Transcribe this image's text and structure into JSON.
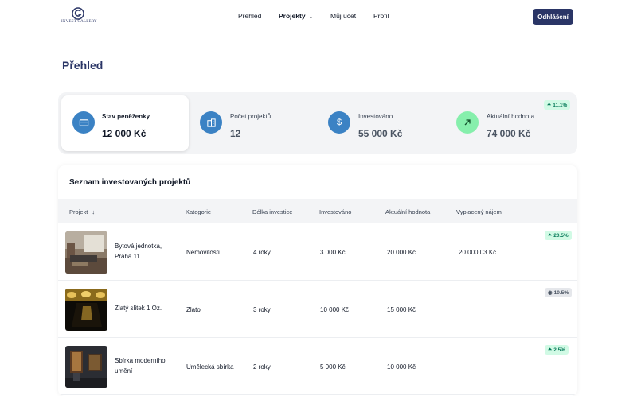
{
  "brand": {
    "logo_text": "INVEST GALLERY"
  },
  "nav": {
    "items": [
      {
        "label": "Přehled"
      },
      {
        "label": "Projekty"
      },
      {
        "label": "Můj účet"
      },
      {
        "label": "Profil"
      }
    ],
    "logout_label": "Odhlášení"
  },
  "page_title": "Přehled",
  "stats": [
    {
      "label": "Stav peněženky",
      "value": "12 000 Kč",
      "icon": "wallet-icon",
      "color": "#3b82c4"
    },
    {
      "label": "Počet projektů",
      "value": "12",
      "icon": "buildings-icon",
      "color": "#3b82c4"
    },
    {
      "label": "Investováno",
      "value": "55 000 Kč",
      "icon": "dollar-icon",
      "color": "#3b82c4"
    },
    {
      "label": "Aktuální hodnota",
      "value": "74 000 Kč",
      "icon": "arrow-up-right-icon",
      "color": "#86efac",
      "badge": "11.1%"
    }
  ],
  "table": {
    "title": "Seznam investovaných projektů",
    "headers": {
      "project": "Projekt",
      "category": "Kategorie",
      "duration": "Délka investice",
      "invested": "Investováno",
      "current": "Aktuální hodnota",
      "rent": "Vyplacený nájem"
    },
    "rows": [
      {
        "name": "Bytová jednotka, Praha 11",
        "category": "Nemovitosti",
        "duration": "4 roky",
        "invested": "3 000 Kč",
        "current": "20 000 Kč",
        "rent": "20 000,03 Kč",
        "badge": "20.5%",
        "trend": "up"
      },
      {
        "name": "Zlatý slitek 1 Oz.",
        "category": "Zlato",
        "duration": "3 roky",
        "invested": "10 000 Kč",
        "current": "15 000 Kč",
        "rent": "",
        "badge": "10.5%",
        "trend": "neutral"
      },
      {
        "name": "Sbírka moderního umění",
        "category": "Umělecká sbírka",
        "duration": "2 roky",
        "invested": "5 000 Kč",
        "current": "10 000 Kč",
        "rent": "",
        "badge": "2.5%",
        "trend": "up"
      }
    ]
  },
  "colors": {
    "brand": "#2a3566",
    "accent_blue": "#3b82c4",
    "green_badge_bg": "#d1fae5",
    "green_badge_text": "#047857"
  }
}
